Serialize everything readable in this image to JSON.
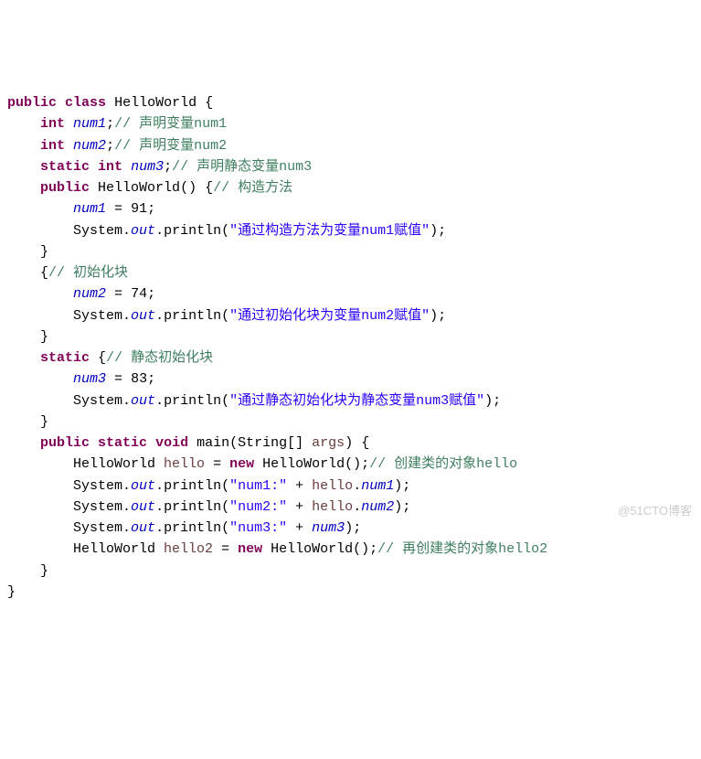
{
  "kw": {
    "public": "public",
    "class": "class",
    "int": "int",
    "static": "static",
    "new": "new",
    "void": "void"
  },
  "cls": "HelloWorld",
  "fields": {
    "num1_decl": "num1",
    "num2_decl": "num2",
    "num3_decl": "num3"
  },
  "cmt": {
    "c1": "// 声明变量num1",
    "c2": "// 声明变量num2",
    "c3": "// 声明静态变量num3",
    "ctor": "// 构造方法",
    "init": "// 初始化块",
    "sinit": "// 静态初始化块",
    "obj1": "// 创建类的对象hello",
    "obj2": "// 再创建类的对象hello2"
  },
  "vals": {
    "n1": "91",
    "n2": "74",
    "n3": "83"
  },
  "sys": "System",
  "out": "out",
  "println": "println",
  "strs": {
    "s1": "\"通过构造方法为变量num1赋值\"",
    "s2": "\"通过初始化块为变量num2赋值\"",
    "s3": "\"通过静态初始化块为静态变量num3赋值\"",
    "p1": "\"num1:\"",
    "p2": "\"num2:\"",
    "p3": "\"num3:\""
  },
  "main": {
    "name": "main",
    "paramType": "String",
    "paramName": "args"
  },
  "vars": {
    "hello": "hello",
    "hello2": "hello2"
  },
  "refs": {
    "num1": "num1",
    "num2": "num2",
    "num3": "num3"
  },
  "watermark": "@51CTO博客"
}
